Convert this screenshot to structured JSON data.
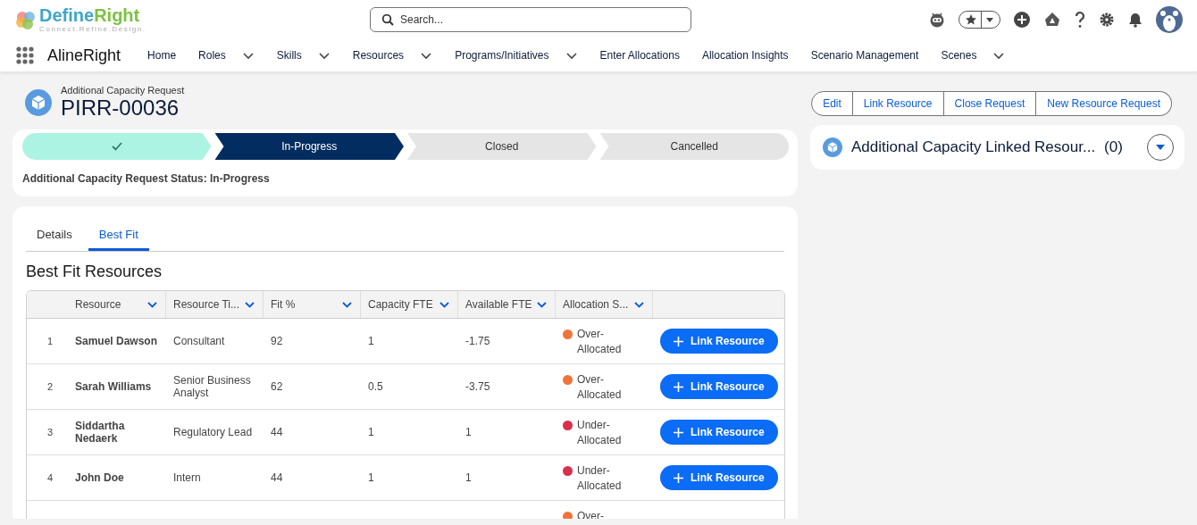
{
  "brand": {
    "name_first": "Define",
    "name_second": "Right",
    "tagline": "Connect.Refine.Design."
  },
  "search": {
    "placeholder": "Search..."
  },
  "app_name": "AlineRight",
  "nav": [
    {
      "label": "Home",
      "has_menu": false
    },
    {
      "label": "Roles",
      "has_menu": true
    },
    {
      "label": "Skills",
      "has_menu": true
    },
    {
      "label": "Resources",
      "has_menu": true
    },
    {
      "label": "Programs/Initiatives",
      "has_menu": true
    },
    {
      "label": "Enter Allocations",
      "has_menu": false
    },
    {
      "label": "Allocation Insights",
      "has_menu": false
    },
    {
      "label": "Scenario Management",
      "has_menu": false
    },
    {
      "label": "Scenes",
      "has_menu": true
    }
  ],
  "record": {
    "type": "Additional Capacity Request",
    "title": "PIRR-00036"
  },
  "actions": [
    "Edit",
    "Link Resource",
    "Close Request",
    "New Resource Request"
  ],
  "path": [
    {
      "completed": true,
      "selected": false
    },
    {
      "label": "In-Progress",
      "completed": false,
      "selected": true
    },
    {
      "label": "Closed",
      "completed": false,
      "selected": false
    },
    {
      "label": "Cancelled",
      "completed": false,
      "selected": false
    }
  ],
  "status_text": "Additional Capacity Request Status: In-Progress",
  "related": {
    "title": "Additional Capacity Linked Resour...",
    "count": "(0)"
  },
  "tabs": [
    {
      "label": "Details",
      "selected": false
    },
    {
      "label": "Best Fit",
      "selected": true
    }
  ],
  "section_title": "Best Fit Resources",
  "table": {
    "columns": [
      "Resource",
      "Resource Ti...",
      "Fit %",
      "Capacity FTE",
      "Available FTE",
      "Allocation S..."
    ],
    "rows": [
      {
        "index": "1",
        "resource": "Samuel Dawson",
        "title": "Consultant",
        "fit": "92",
        "capacity": "1",
        "available": "-1.75",
        "status": "Over-Allocated",
        "color": "#f0743a",
        "action": "Link Resource"
      },
      {
        "index": "2",
        "resource": "Sarah Williams",
        "title": "Senior Business Analyst",
        "fit": "62",
        "capacity": "0.5",
        "available": "-3.75",
        "status": "Over-Allocated",
        "color": "#f0743a",
        "action": "Link Resource"
      },
      {
        "index": "3",
        "resource": "Siddartha Nedaerk",
        "title": "Regulatory Lead",
        "fit": "44",
        "capacity": "1",
        "available": "1",
        "status": "Under-Allocated",
        "color": "#d92f4a",
        "action": "Link Resource"
      },
      {
        "index": "4",
        "resource": "John Doe",
        "title": "Intern",
        "fit": "44",
        "capacity": "1",
        "available": "1",
        "status": "Under-Allocated",
        "color": "#d92f4a",
        "action": "Link Resource"
      },
      {
        "status": "Over-",
        "color": "#f0743a"
      }
    ]
  }
}
